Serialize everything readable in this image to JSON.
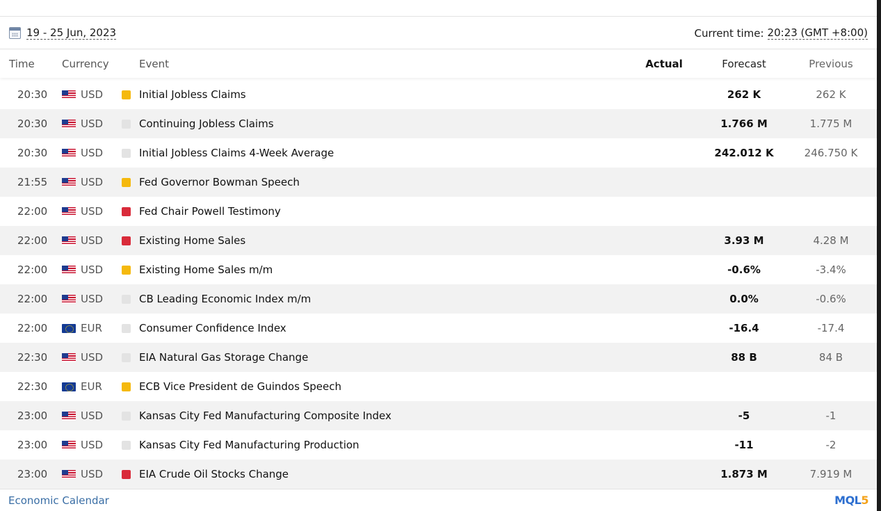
{
  "header": {
    "date_range": "19 - 25 Jun, 2023",
    "current_time_label": "Current time:",
    "current_time_value": "20:23 (GMT +8:00)"
  },
  "columns": {
    "time": "Time",
    "currency": "Currency",
    "event": "Event",
    "actual": "Actual",
    "forecast": "Forecast",
    "previous": "Previous"
  },
  "rows": [
    {
      "time": "20:30",
      "currency": "USD",
      "flag": "us-flag",
      "importance": "medium",
      "event": "Initial Jobless Claims",
      "actual": "",
      "forecast": "262 K",
      "previous": "262 K"
    },
    {
      "time": "20:30",
      "currency": "USD",
      "flag": "us-flag",
      "importance": "low",
      "event": "Continuing Jobless Claims",
      "actual": "",
      "forecast": "1.766 M",
      "previous": "1.775 M"
    },
    {
      "time": "20:30",
      "currency": "USD",
      "flag": "us-flag",
      "importance": "low",
      "event": "Initial Jobless Claims 4-Week Average",
      "actual": "",
      "forecast": "242.012 K",
      "previous": "246.750 K"
    },
    {
      "time": "21:55",
      "currency": "USD",
      "flag": "us-flag",
      "importance": "medium",
      "event": "Fed Governor Bowman Speech",
      "actual": "",
      "forecast": "",
      "previous": ""
    },
    {
      "time": "22:00",
      "currency": "USD",
      "flag": "us-flag",
      "importance": "high",
      "event": "Fed Chair Powell Testimony",
      "actual": "",
      "forecast": "",
      "previous": ""
    },
    {
      "time": "22:00",
      "currency": "USD",
      "flag": "us-flag",
      "importance": "high",
      "event": "Existing Home Sales",
      "actual": "",
      "forecast": "3.93 M",
      "previous": "4.28 M"
    },
    {
      "time": "22:00",
      "currency": "USD",
      "flag": "us-flag",
      "importance": "medium",
      "event": "Existing Home Sales m/m",
      "actual": "",
      "forecast": "-0.6%",
      "previous": "-3.4%"
    },
    {
      "time": "22:00",
      "currency": "USD",
      "flag": "us-flag",
      "importance": "low",
      "event": "CB Leading Economic Index m/m",
      "actual": "",
      "forecast": "0.0%",
      "previous": "-0.6%"
    },
    {
      "time": "22:00",
      "currency": "EUR",
      "flag": "eu-flag",
      "importance": "low",
      "event": "Consumer Confidence Index",
      "actual": "",
      "forecast": "-16.4",
      "previous": "-17.4"
    },
    {
      "time": "22:30",
      "currency": "USD",
      "flag": "us-flag",
      "importance": "low",
      "event": "EIA Natural Gas Storage Change",
      "actual": "",
      "forecast": "88 B",
      "previous": "84 B"
    },
    {
      "time": "22:30",
      "currency": "EUR",
      "flag": "eu-flag",
      "importance": "medium",
      "event": "ECB Vice President de Guindos Speech",
      "actual": "",
      "forecast": "",
      "previous": ""
    },
    {
      "time": "23:00",
      "currency": "USD",
      "flag": "us-flag",
      "importance": "low",
      "event": "Kansas City Fed Manufacturing Composite Index",
      "actual": "",
      "forecast": "-5",
      "previous": "-1"
    },
    {
      "time": "23:00",
      "currency": "USD",
      "flag": "us-flag",
      "importance": "low",
      "event": "Kansas City Fed Manufacturing Production",
      "actual": "",
      "forecast": "-11",
      "previous": "-2"
    },
    {
      "time": "23:00",
      "currency": "USD",
      "flag": "us-flag",
      "importance": "high",
      "event": "EIA Crude Oil Stocks Change",
      "actual": "",
      "forecast": "1.873 M",
      "previous": "7.919 M"
    }
  ],
  "importance_colors": {
    "high": "#d92b3a",
    "medium": "#f5b90d",
    "low": "#e3e3e3"
  },
  "footer": {
    "link_text": "Economic Calendar",
    "logo_main": "MQL",
    "logo_accent": "5"
  }
}
